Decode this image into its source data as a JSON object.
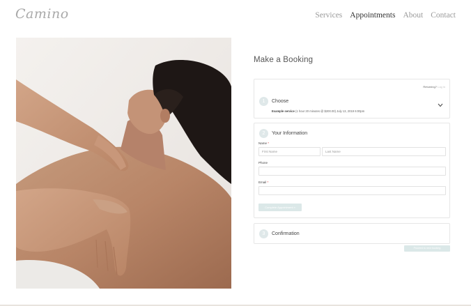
{
  "brand": {
    "logo": "Camino"
  },
  "nav": {
    "items": [
      "Services",
      "Appointments",
      "About",
      "Contact"
    ],
    "active": "Appointments"
  },
  "hero_image": {
    "description": "massage"
  },
  "booking": {
    "title": "Make a Booking",
    "step1": {
      "number": "1",
      "title": "Choose",
      "returning_label": "Returning?",
      "login_link": "Log in",
      "summary_service": "Example service",
      "summary_detail": "(1 hour 20 minutes @ $200.00) July 13, 2019 6:00pm",
      "chevron_icon": "chevron-down-icon"
    },
    "step2": {
      "number": "2",
      "title": "Your Information",
      "name_label": "Name",
      "first_name_placeholder": "First Name",
      "last_name_placeholder": "Last Name",
      "phone_label": "Phone",
      "email_label": "Email",
      "required_mark": "*",
      "submit_label": "Complete Appointment »"
    },
    "step3": {
      "number": "3",
      "title": "Confirmation"
    },
    "proceed_label": "Proceed to next booking"
  },
  "colors": {
    "accent": "#dbe8e8",
    "step_circle": "#dfe8e9",
    "nav_active": "#333333",
    "nav_inactive": "#9a9a9a"
  }
}
